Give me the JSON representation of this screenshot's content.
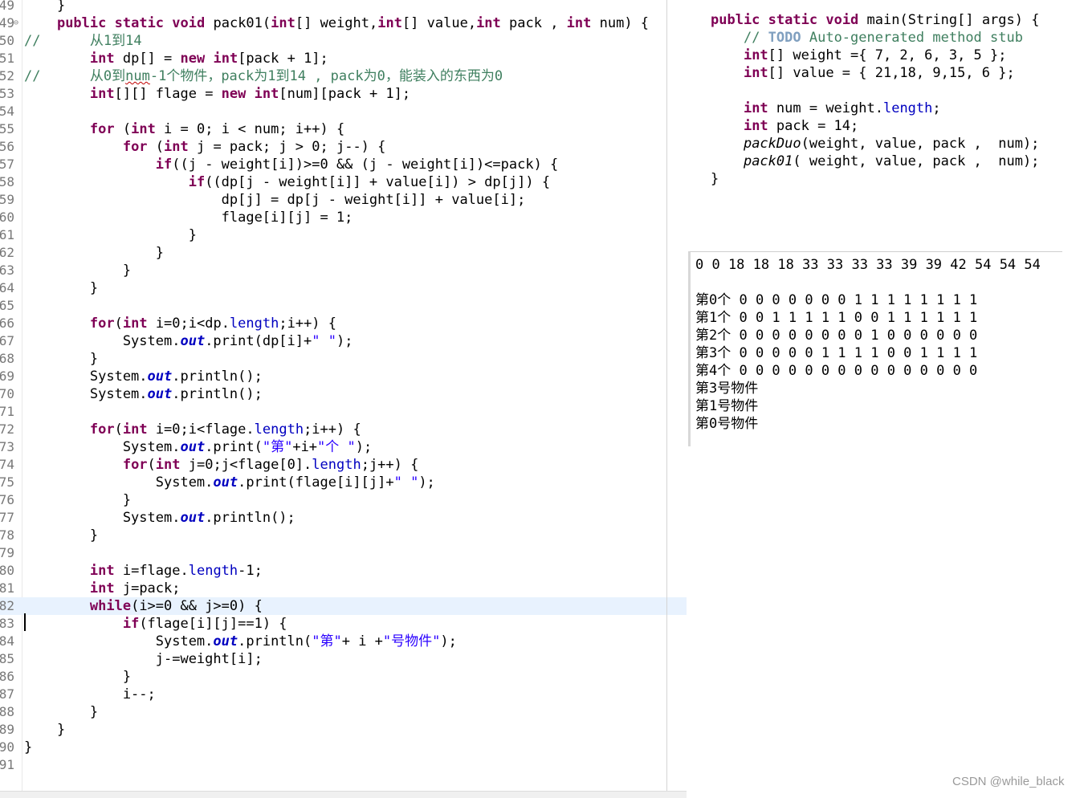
{
  "editor": {
    "current_line_number": "82",
    "lines": [
      {
        "ln": "49",
        "html": "    }"
      },
      {
        "ln": "49",
        "fold": "⊖",
        "html": "    <span class='kw'>public</span> <span class='kw'>static</span> <span class='kw'>void</span> pack01(<span class='kw'>int</span>[] weight,<span class='kw'>int</span>[] value,<span class='kw'>int</span> pack , <span class='kw'>int</span> num) {"
      },
      {
        "ln": "50",
        "html": "<span class='cm'>//      从1到14</span>"
      },
      {
        "ln": "51",
        "html": "        <span class='kw'>int</span> dp[] = <span class='kw'>new</span> <span class='kw'>int</span>[pack + 1];"
      },
      {
        "ln": "52",
        "html": "<span class='cm'>//      从0到<span class='uline'>num</span>-1个物件，pack为1到14 , pack为0，能装入的东西为0</span>"
      },
      {
        "ln": "53",
        "html": "        <span class='kw'>int</span>[][] flage = <span class='kw'>new</span> <span class='kw'>int</span>[num][pack + 1];"
      },
      {
        "ln": "54",
        "html": ""
      },
      {
        "ln": "55",
        "html": "        <span class='kw'>for</span> (<span class='kw'>int</span> i = 0; i &lt; num; i++) {"
      },
      {
        "ln": "56",
        "html": "            <span class='kw'>for</span> (<span class='kw'>int</span> j = pack; j &gt; 0; j--) {"
      },
      {
        "ln": "57",
        "html": "                <span class='kw'>if</span>((j - weight[i])&gt;=0 &amp;&amp; (j - weight[i])&lt;=pack) {"
      },
      {
        "ln": "58",
        "html": "                    <span class='kw'>if</span>((dp[j - weight[i]] + value[i]) &gt; dp[j]) {"
      },
      {
        "ln": "59",
        "html": "                        dp[j] = dp[j - weight[i]] + value[i];"
      },
      {
        "ln": "60",
        "html": "                        flage[i][j] = 1;"
      },
      {
        "ln": "61",
        "html": "                    }"
      },
      {
        "ln": "62",
        "html": "                }"
      },
      {
        "ln": "63",
        "html": "            }"
      },
      {
        "ln": "64",
        "html": "        }"
      },
      {
        "ln": "65",
        "html": ""
      },
      {
        "ln": "66",
        "html": "        <span class='kw'>for</span>(<span class='kw'>int</span> i=0;i&lt;dp.<span class='fld'>length</span>;i++) {"
      },
      {
        "ln": "67",
        "html": "            System.<span class='sfld'>out</span>.print(dp[i]+<span class='str'>\" \"</span>);"
      },
      {
        "ln": "68",
        "html": "        }"
      },
      {
        "ln": "69",
        "html": "        System.<span class='sfld'>out</span>.println();"
      },
      {
        "ln": "70",
        "html": "        System.<span class='sfld'>out</span>.println();"
      },
      {
        "ln": "71",
        "html": ""
      },
      {
        "ln": "72",
        "html": "        <span class='kw'>for</span>(<span class='kw'>int</span> i=0;i&lt;flage.<span class='fld'>length</span>;i++) {"
      },
      {
        "ln": "73",
        "html": "            System.<span class='sfld'>out</span>.print(<span class='str'>\"第\"</span>+i+<span class='str'>\"个 \"</span>);"
      },
      {
        "ln": "74",
        "html": "            <span class='kw'>for</span>(<span class='kw'>int</span> j=0;j&lt;flage[0].<span class='fld'>length</span>;j++) {"
      },
      {
        "ln": "75",
        "html": "                System.<span class='sfld'>out</span>.print(flage[i][j]+<span class='str'>\" \"</span>);"
      },
      {
        "ln": "76",
        "html": "            }"
      },
      {
        "ln": "77",
        "html": "            System.<span class='sfld'>out</span>.println();"
      },
      {
        "ln": "78",
        "html": "        }"
      },
      {
        "ln": "79",
        "html": ""
      },
      {
        "ln": "80",
        "html": "        <span class='kw'>int</span> i=flage.<span class='fld'>length</span>-1;"
      },
      {
        "ln": "81",
        "html": "        <span class='kw'>int</span> j=pack;"
      },
      {
        "ln": "82",
        "html": "        <span class='kw'>while</span>(i&gt;=0 &amp;&amp; j&gt;=0) {"
      },
      {
        "ln": "83",
        "html": "            <span class='kw'>if</span>(flage[i][j]==1) {"
      },
      {
        "ln": "84",
        "html": "                System.<span class='sfld'>out</span>.println(<span class='str'>\"第\"</span>+ i +<span class='str'>\"号物件\"</span>);"
      },
      {
        "ln": "85",
        "html": "                j-=weight[i];"
      },
      {
        "ln": "86",
        "html": "            }"
      },
      {
        "ln": "87",
        "html": "            i--;"
      },
      {
        "ln": "88",
        "html": "        }"
      },
      {
        "ln": "89",
        "html": "    }"
      },
      {
        "ln": "90",
        "html": "}"
      },
      {
        "ln": "91",
        "html": ""
      }
    ]
  },
  "main_method": {
    "lines": [
      {
        "html": "<span class='kw'>public</span> <span class='kw'>static</span> <span class='kw'>void</span> main(String[] args) {"
      },
      {
        "html": "    <span class='cm'>// <span class='todo'>TODO</span> Auto-generated method stub</span>"
      },
      {
        "html": "    <span class='kw'>int</span>[] weight ={ 7, 2, 6, 3, 5 };"
      },
      {
        "html": "    <span class='kw'>int</span>[] value = { 21,18, 9,15, 6 };"
      },
      {
        "html": ""
      },
      {
        "html": "    <span class='kw'>int</span> num = weight.<span class='fld'>length</span>;"
      },
      {
        "html": "    <span class='kw'>int</span> pack = 14;"
      },
      {
        "html": "    <span class='sm'>packDuo</span>(weight, value, pack ,  num);"
      },
      {
        "html": "    <span class='sm'>pack01</span>( weight, value, pack ,  num);"
      },
      {
        "html": "}"
      }
    ]
  },
  "console": {
    "lines": [
      "0 0 18 18 18 33 33 33 33 39 39 42 54 54 54",
      "",
      "第0个 0 0 0 0 0 0 0 1 1 1 1 1 1 1 1",
      "第1个 0 0 1 1 1 1 1 0 0 1 1 1 1 1 1",
      "第2个 0 0 0 0 0 0 0 0 1 0 0 0 0 0 0",
      "第3个 0 0 0 0 0 1 1 1 1 0 0 1 1 1 1",
      "第4个 0 0 0 0 0 0 0 0 0 0 0 0 0 0 0",
      "第3号物件",
      "第1号物件",
      "第0号物件"
    ]
  },
  "watermark": "CSDN @while_black"
}
